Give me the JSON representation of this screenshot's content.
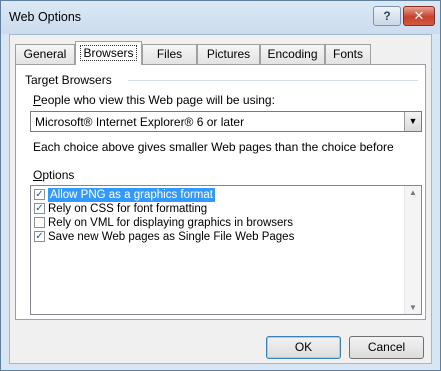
{
  "window": {
    "title": "Web Options"
  },
  "title_buttons": {
    "help_glyph": "?",
    "close_glyph": "✕"
  },
  "tabs": [
    {
      "label": "General",
      "active": false
    },
    {
      "label": "Browsers",
      "active": true
    },
    {
      "label": "Files",
      "active": false
    },
    {
      "label": "Pictures",
      "active": false
    },
    {
      "label": "Encoding",
      "active": false
    },
    {
      "label": "Fonts",
      "active": false
    }
  ],
  "target_browsers": {
    "group_label": "Target Browsers",
    "prompt_first": "P",
    "prompt_rest": "eople who view this Web page will be using:",
    "selected_value": "Microsoft® Internet Explorer® 6 or later",
    "hint": "Each choice above gives smaller Web pages than the choice before"
  },
  "options": {
    "group_first": "O",
    "group_rest": "ptions",
    "items": [
      {
        "label": "Allow PNG as a graphics format",
        "checked": true,
        "selected": true
      },
      {
        "label": "Rely on CSS for font formatting",
        "checked": true,
        "selected": false
      },
      {
        "label": "Rely on VML for displaying graphics in browsers",
        "checked": false,
        "selected": false
      },
      {
        "label": "Save new Web pages as Single File Web Pages",
        "checked": true,
        "selected": false
      }
    ]
  },
  "buttons": {
    "ok": "OK",
    "cancel": "Cancel"
  },
  "colors": {
    "selection": "#3399ff",
    "close_button": "#c8412c",
    "frame": "#d8e6f3"
  }
}
